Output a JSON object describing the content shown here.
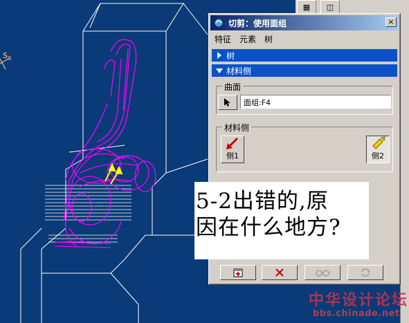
{
  "dialog": {
    "title": "切剪：使用面组",
    "close_label": "×",
    "menu": [
      "特征",
      "元素",
      "树"
    ],
    "sections": [
      {
        "label": "树",
        "expanded": false
      },
      {
        "label": "材料侧",
        "expanded": true
      }
    ],
    "surface_group": {
      "label": "曲面",
      "value": "面组:F4"
    },
    "material_side_group": {
      "label": "材料侧",
      "side1_label": "侧1",
      "side2_label": "侧2",
      "selected": "侧2"
    },
    "footer_buttons": [
      "preview-icon",
      "cancel-icon",
      "glasses-icon",
      "repeat-icon"
    ]
  },
  "viewport": {
    "axis_label": "S",
    "axis_sub": "X",
    "background": "#0a3a78",
    "model_color": "#ff00ff",
    "wire_color": "#ffffff"
  },
  "comment": {
    "line1": "5-2出错的,原",
    "line2": "因在什么地方?"
  },
  "watermark": {
    "site_name": "中华设计论坛",
    "site_url": "bbs.chinade.net"
  },
  "colors": {
    "section_bar": "#0a52c8",
    "title_gradient_start": "#0a246a",
    "title_gradient_end": "#a6caf0",
    "watermark": "#c8324a"
  }
}
